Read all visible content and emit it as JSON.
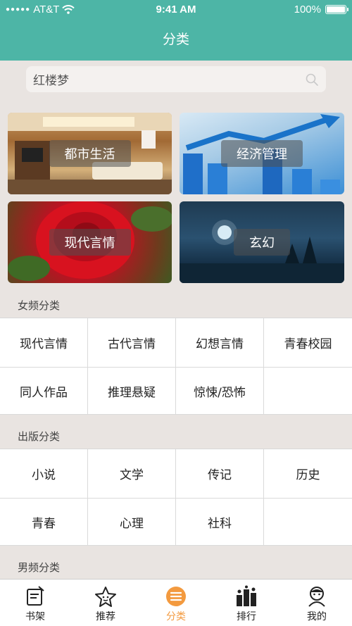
{
  "status": {
    "carrier": "AT&T",
    "time": "9:41 AM",
    "battery": "100%"
  },
  "header": {
    "title": "分类"
  },
  "search": {
    "value": "红楼梦"
  },
  "covers": [
    {
      "label": "都市生活"
    },
    {
      "label": "经济管理"
    },
    {
      "label": "现代言情"
    },
    {
      "label": "玄幻"
    }
  ],
  "sections": [
    {
      "title": "女频分类",
      "items": [
        "现代言情",
        "古代言情",
        "幻想言情",
        "青春校园",
        "同人作品",
        "推理悬疑",
        "惊悚/恐怖"
      ]
    },
    {
      "title": "出版分类",
      "items": [
        "小说",
        "文学",
        "传记",
        "历史",
        "青春",
        "心理",
        "社科"
      ]
    },
    {
      "title": "男频分类"
    }
  ],
  "tabs": [
    {
      "label": "书架",
      "icon": "bookshelf-icon"
    },
    {
      "label": "推荐",
      "icon": "star-icon"
    },
    {
      "label": "分类",
      "icon": "category-icon",
      "active": true
    },
    {
      "label": "排行",
      "icon": "ranking-icon"
    },
    {
      "label": "我的",
      "icon": "profile-icon"
    }
  ],
  "colors": {
    "theme": "#4db5a6",
    "active_tab": "#f39a3f"
  }
}
